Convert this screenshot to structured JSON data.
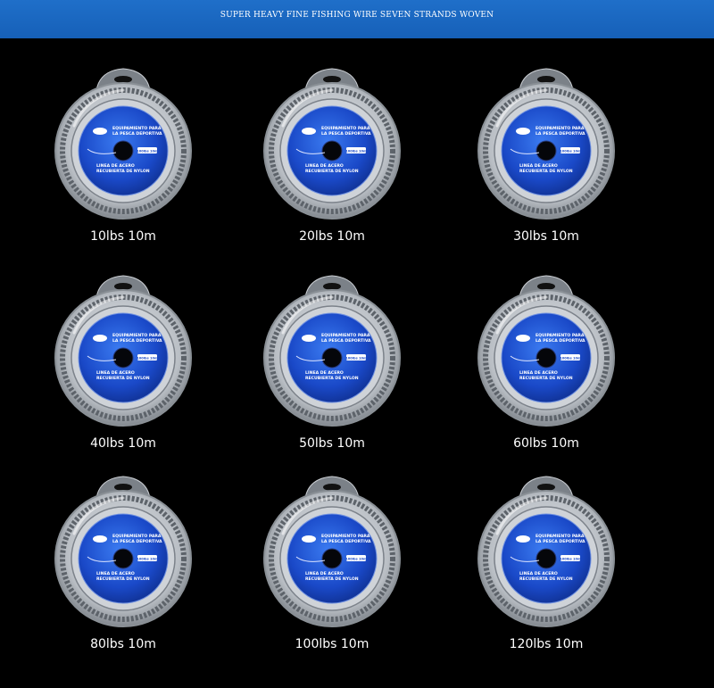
{
  "banner": {
    "title": "SUPER HEAVY FINE FISHING WIRE SEVEN STRANDS WOVEN",
    "color": "#1b67c0"
  },
  "label": {
    "line1": "EQUIPAMIENTO PARA",
    "line2": "LA PESCA DEPORTIVA",
    "line3": "LINEA DE ACERO",
    "line4": "RECUBIERTA DE NYLON",
    "badge": "100lbs 10m",
    "color": "#1a49c8"
  },
  "products": [
    {
      "caption": "10lbs 10m"
    },
    {
      "caption": "20lbs 10m"
    },
    {
      "caption": "30lbs 10m"
    },
    {
      "caption": "40lbs 10m"
    },
    {
      "caption": "50lbs 10m"
    },
    {
      "caption": "60lbs 10m"
    },
    {
      "caption": "80lbs 10m"
    },
    {
      "caption": "100lbs 10m"
    },
    {
      "caption": "120lbs 10m"
    }
  ]
}
